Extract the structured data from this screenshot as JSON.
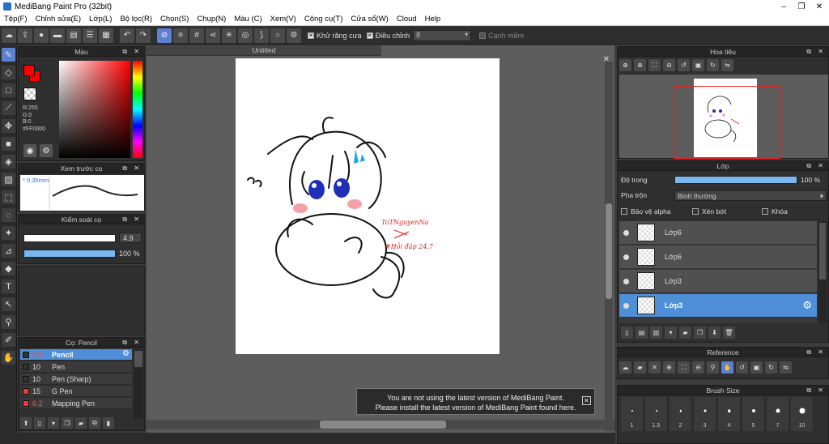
{
  "window": {
    "title": "MediBang Paint Pro (32bit)",
    "minimize": "–",
    "maximize": "❐",
    "close": "✕"
  },
  "menu": [
    "Tệp(F)",
    "Chỉnh sửa(E)",
    "Lớp(L)",
    "Bộ lọc(R)",
    "Chọn(S)",
    "Chụp(N)",
    "Màu (C)",
    "Xem(V)",
    "Công cụ(T)",
    "Cửa sổ(W)",
    "Cloud",
    "Help"
  ],
  "toolbar": {
    "antialias_label": "Khử răng cưa",
    "correction_label": "Điều chỉnh",
    "correction_value": "8",
    "snap_label": "Cạnh mềm"
  },
  "color_panel": {
    "title": "Màu",
    "color": "#ff0000",
    "r": "R:255",
    "g": "G:0",
    "b": "B:0",
    "hex": "#FF0000"
  },
  "preview_panel": {
    "title": "Xem trước cọ",
    "size": "* 0.35mm"
  },
  "control_panel": {
    "title": "Kiểm soát cọ",
    "size_value": "4.9",
    "opacity_value": "100 %",
    "size_fill": 1.0,
    "opacity_fill": 1.0
  },
  "brush_panel": {
    "title": "Cọ: Pencil",
    "items": [
      {
        "size": "4.9",
        "name": "Pencil",
        "color": "#333333",
        "red": true,
        "active": true
      },
      {
        "size": "10",
        "name": "Pen",
        "color": "#333333",
        "red": false,
        "active": false
      },
      {
        "size": "10",
        "name": "Pen (Sharp)",
        "color": "#333333",
        "red": false,
        "active": false
      },
      {
        "size": "15",
        "name": "G Pen",
        "color": "#ff3030",
        "red": false,
        "active": false
      },
      {
        "size": "6.2",
        "name": "Mapping Pen",
        "color": "#ff3030",
        "red": true,
        "active": false
      }
    ]
  },
  "canvas": {
    "tab_title": "Untitled",
    "sketch_text_1": "ToTNguyenNa",
    "sketch_text_2": "#Hỏi đáp 24,7"
  },
  "toast": {
    "line1": "You are not using the latest version of MediBang Paint.",
    "line2": "Please install the latest version of MediBang Paint found here.",
    "close": "✕"
  },
  "navigator": {
    "title": "Hoa tiêu"
  },
  "layer_panel": {
    "title": "Lớp",
    "opacity_label": "Độ trong",
    "opacity_value": "100 %",
    "blend_label": "Pha trộn",
    "blend_value": "Bình thường",
    "protect_alpha": "Bảo vệ alpha",
    "clipping": "Xén bớt",
    "lock": "Khóa",
    "layers": [
      {
        "name": "Lớp6",
        "active": false
      },
      {
        "name": "Lớp6",
        "active": false
      },
      {
        "name": "Lớp3",
        "active": false
      },
      {
        "name": "Lớp3",
        "active": true
      }
    ]
  },
  "reference_panel": {
    "title": "Reference"
  },
  "brush_size_panel": {
    "title": "Brush Size",
    "sizes": [
      "1",
      "1.5",
      "2",
      "3",
      "4",
      "5",
      "7",
      "10"
    ]
  }
}
